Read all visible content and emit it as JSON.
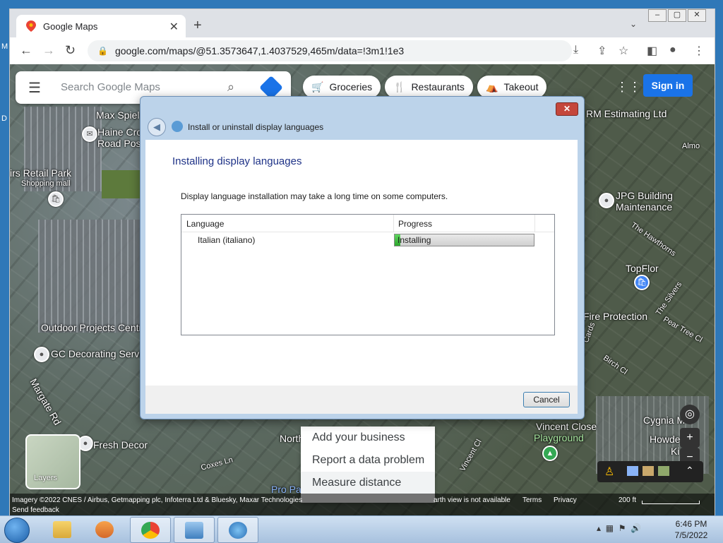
{
  "browser": {
    "tab_title": "Google Maps",
    "tab_close": "✕",
    "new_tab": "+",
    "url": "google.com/maps/@51.3573647,1.4037529,465m/data=!3m1!1e3",
    "window_controls": [
      "‒",
      "▢",
      "✕"
    ]
  },
  "maps": {
    "search_placeholder": "Search Google Maps",
    "chips": [
      {
        "label": "Groceries",
        "icon": "🛒"
      },
      {
        "label": "Restaurants",
        "icon": "🍴"
      },
      {
        "label": "Takeout",
        "icon": "⛺"
      }
    ],
    "sign_in": "Sign in",
    "layers_label": "Layers",
    "labels": [
      "Max Spiel",
      "Haine Cro",
      "Road Pos",
      "irs Retail Park",
      "Shopping mall",
      "RM Estimating Ltd",
      "JPG Building",
      "Maintenance",
      "TopFlor",
      "Fire Protection",
      "The Hawthorns",
      "The Silvers",
      "Pear Tree Cl",
      "Birch Cl",
      "Outdoor Projects Centr",
      "GC Decorating Servic",
      "Margate Rd",
      "Fresh Decor",
      "Coxes Ln",
      "North",
      "Pro Pa",
      "Vincent Cl",
      "Vincent Close",
      "Playground",
      "Cygnia M",
      "Howde",
      "Ki",
      "Almo",
      "Cards"
    ],
    "context_menu": [
      "Add your business",
      "Report a data problem",
      "Measure distance"
    ],
    "footer": {
      "imagery": "Imagery ©2022 CNES / Airbus, Getmapping plc, Infoterra Ltd & Bluesky, Maxar Technologies",
      "earth_view": "arth view is not available",
      "terms": "Terms",
      "privacy": "Privacy",
      "scale": "200 ft",
      "send_feedback": "Send feedback"
    }
  },
  "dialog": {
    "title": "Install or uninstall display languages",
    "heading": "Installing display languages",
    "note": "Display language installation may take a long time on some computers.",
    "columns": [
      "Language",
      "Progress"
    ],
    "rows": [
      {
        "language": "Italian (italiano)",
        "status": "Installing",
        "progress": 0.04
      }
    ],
    "cancel": "Cancel"
  },
  "taskbar": {
    "time": "6:46 PM",
    "date": "7/5/2022"
  },
  "desktop": {
    "letters": [
      "M",
      "D"
    ]
  },
  "colors": {
    "accent": "#1a73e8",
    "progress_fill": "#2da52d",
    "close_red": "#c4463b"
  }
}
